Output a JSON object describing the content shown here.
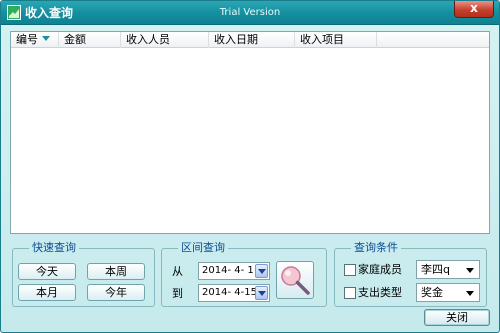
{
  "window": {
    "title": "收入查询",
    "watermark": "Trial  Version",
    "close_glyph": "x"
  },
  "list": {
    "columns": [
      {
        "label": "编号",
        "sorted": true
      },
      {
        "label": "金额"
      },
      {
        "label": "收入人员"
      },
      {
        "label": "收入日期"
      },
      {
        "label": "收入项目"
      }
    ]
  },
  "quick_query": {
    "legend": "快速查询",
    "today_label": "今天",
    "this_week_label": "本周",
    "this_month_label": "本月",
    "this_year_label": "今年"
  },
  "range_query": {
    "legend": "区间查询",
    "from_label": "从",
    "to_label": "到",
    "from_date": "2014- 4- 1",
    "to_date": "2014- 4-15"
  },
  "conditions": {
    "legend": "查询条件",
    "family_member_label": "家庭成员",
    "family_member_value": "李四q",
    "family_member_checked": false,
    "expense_type_label": "支出类型",
    "expense_type_value": "奖金",
    "expense_type_checked": false
  },
  "footer": {
    "close_label": "关闭"
  },
  "colors": {
    "titlebar": "#1590a0",
    "window_bg": "#cbecee",
    "legend_text": "#0b4c96",
    "close_button": "#c8402c"
  }
}
